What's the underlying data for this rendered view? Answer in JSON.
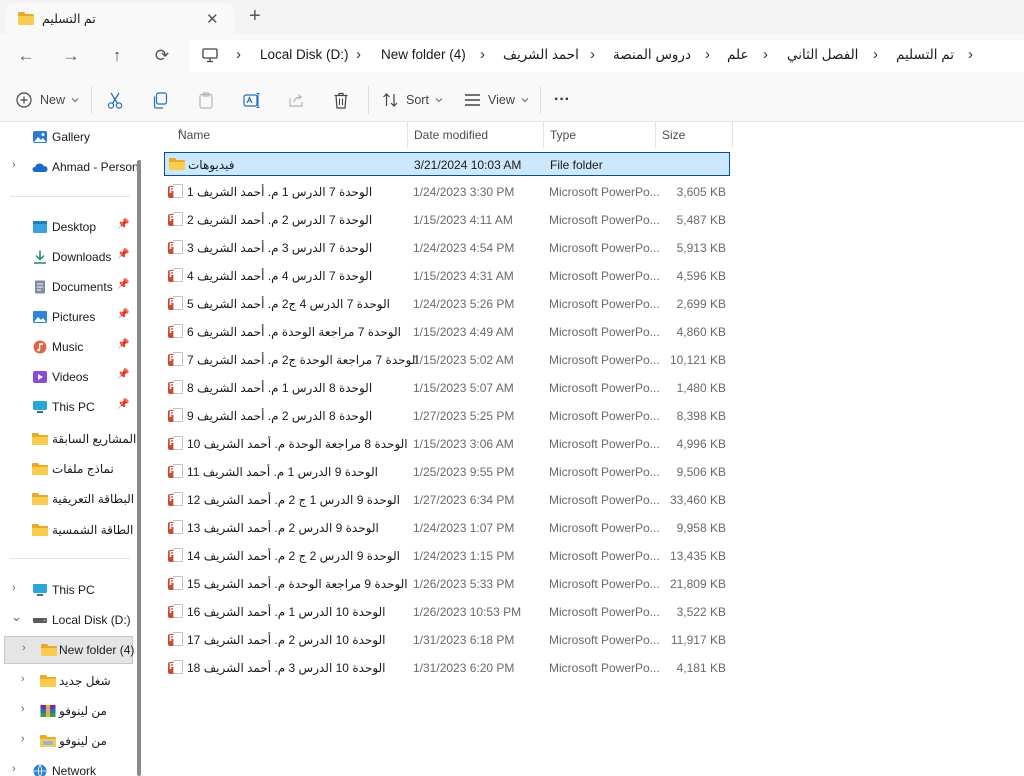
{
  "tab": {
    "title": "تم التسليم",
    "close": "✕",
    "new_tab": "+"
  },
  "nav": {
    "back": "←",
    "forward": "→",
    "up": "↑",
    "refresh": "⟳"
  },
  "breadcrumbs": [
    "Local Disk (D:)",
    "New folder (4)",
    "احمد الشريف",
    "دروس المنصة",
    "علم",
    "الفصل الثاني",
    "تم التسليم"
  ],
  "breadcrumb_separator": "›",
  "toolbar": {
    "new_label": "New",
    "sort_label": "Sort",
    "view_label": "View",
    "more_label": "···"
  },
  "sidebar": {
    "top_items": [
      {
        "label": "Gallery",
        "icon": "gallery-icon"
      },
      {
        "label": "Ahmad - Person",
        "icon": "onedrive-icon"
      }
    ],
    "quick_access": [
      {
        "label": "Desktop",
        "icon": "desktop-icon",
        "pinned": true
      },
      {
        "label": "Downloads",
        "icon": "download-icon",
        "pinned": true
      },
      {
        "label": "Documents",
        "icon": "document-icon",
        "pinned": true
      },
      {
        "label": "Pictures",
        "icon": "pictures-icon",
        "pinned": true
      },
      {
        "label": "Music",
        "icon": "music-icon",
        "pinned": true
      },
      {
        "label": "Videos",
        "icon": "videos-icon",
        "pinned": true
      },
      {
        "label": "This PC",
        "icon": "pc-icon",
        "pinned": true
      },
      {
        "label": "المشاريع السابقة",
        "icon": "folder-icon",
        "pinned": false
      },
      {
        "label": "نماذج ملفات",
        "icon": "folder-icon",
        "pinned": false
      },
      {
        "label": "البطاقة التعريفية",
        "icon": "folder-icon",
        "pinned": false
      },
      {
        "label": "الطاقة الشمسية",
        "icon": "folder-icon",
        "pinned": false
      }
    ],
    "tree": [
      {
        "label": "This PC",
        "icon": "pc-icon",
        "chevron": "›"
      },
      {
        "label": "Local Disk (D:)",
        "icon": "drive-icon",
        "chevron": "⌄"
      },
      {
        "label": "New folder (4)",
        "icon": "folder-icon",
        "chevron": "›",
        "selected": true
      },
      {
        "label": "شغل جديد",
        "icon": "folder-icon",
        "chevron": "›"
      },
      {
        "label": "من لينوفو",
        "icon": "winrar-icon",
        "chevron": "›"
      },
      {
        "label": "من لينوفو",
        "icon": "folder-icon",
        "chevron": "›"
      },
      {
        "label": "Network",
        "icon": "network-icon",
        "chevron": "›"
      }
    ]
  },
  "columns": {
    "name": "Name",
    "date": "Date modified",
    "type": "Type",
    "size": "Size",
    "sort_indicator": "^"
  },
  "files": [
    {
      "name": "فيديوهات",
      "date": "3/21/2024 10:03 AM",
      "type": "File folder",
      "size": "",
      "kind": "folder",
      "selected": true
    },
    {
      "name": "الوحدة 7 الدرس 1 م. أحمد الشريف 1",
      "date": "1/24/2023 3:30 PM",
      "type": "Microsoft PowerPo...",
      "size": "3,605 KB",
      "kind": "ppt"
    },
    {
      "name": "الوحدة 7 الدرس 2 م. أحمد الشريف 2",
      "date": "1/15/2023 4:11 AM",
      "type": "Microsoft PowerPo...",
      "size": "5,487 KB",
      "kind": "ppt"
    },
    {
      "name": "الوحدة 7 الدرس 3 م. أحمد الشريف 3",
      "date": "1/24/2023 4:54 PM",
      "type": "Microsoft PowerPo...",
      "size": "5,913 KB",
      "kind": "ppt"
    },
    {
      "name": "الوحدة 7 الدرس 4 م. أحمد الشريف 4",
      "date": "1/15/2023 4:31 AM",
      "type": "Microsoft PowerPo...",
      "size": "4,596 KB",
      "kind": "ppt"
    },
    {
      "name": "الوحدة 7 الدرس 4 ج2 م. أحمد الشريف 5",
      "date": "1/24/2023 5:26 PM",
      "type": "Microsoft PowerPo...",
      "size": "2,699 KB",
      "kind": "ppt"
    },
    {
      "name": "الوحدة 7 مراجعة الوحدة م. أحمد الشريف 6",
      "date": "1/15/2023 4:49 AM",
      "type": "Microsoft PowerPo...",
      "size": "4,860 KB",
      "kind": "ppt"
    },
    {
      "name": "الوحدة 7 مراجعة الوحدة ج2 م. أحمد الشريف 7",
      "date": "1/15/2023 5:02 AM",
      "type": "Microsoft PowerPo...",
      "size": "10,121 KB",
      "kind": "ppt"
    },
    {
      "name": "الوحدة 8 الدرس 1 م. أحمد الشريف 8",
      "date": "1/15/2023 5:07 AM",
      "type": "Microsoft PowerPo...",
      "size": "1,480 KB",
      "kind": "ppt"
    },
    {
      "name": "الوحدة 8 الدرس 2 م. أحمد الشريف 9",
      "date": "1/27/2023 5:25 PM",
      "type": "Microsoft PowerPo...",
      "size": "8,398 KB",
      "kind": "ppt"
    },
    {
      "name": "الوحدة 8 مراجعة الوحدة م. أحمد الشريف 10",
      "date": "1/15/2023 3:06 AM",
      "type": "Microsoft PowerPo...",
      "size": "4,996 KB",
      "kind": "ppt"
    },
    {
      "name": "الوحدة 9 الدرس 1 م. أحمد الشريف 11",
      "date": "1/25/2023 9:55 PM",
      "type": "Microsoft PowerPo...",
      "size": "9,506 KB",
      "kind": "ppt"
    },
    {
      "name": "الوحدة 9 الدرس 1 ج 2 م. أحمد الشريف 12",
      "date": "1/27/2023 6:34 PM",
      "type": "Microsoft PowerPo...",
      "size": "33,460 KB",
      "kind": "ppt"
    },
    {
      "name": "الوحدة 9 الدرس 2 م. أحمد الشريف 13",
      "date": "1/24/2023 1:07 PM",
      "type": "Microsoft PowerPo...",
      "size": "9,958 KB",
      "kind": "ppt"
    },
    {
      "name": "الوحدة 9 الدرس 2 ج 2 م. أحمد الشريف 14",
      "date": "1/24/2023 1:15 PM",
      "type": "Microsoft PowerPo...",
      "size": "13,435 KB",
      "kind": "ppt"
    },
    {
      "name": "الوحدة 9 مراجعة الوحدة م. أحمد الشريف 15",
      "date": "1/26/2023 5:33 PM",
      "type": "Microsoft PowerPo...",
      "size": "21,809 KB",
      "kind": "ppt"
    },
    {
      "name": "الوحدة 10 الدرس 1 م. أحمد الشريف 16",
      "date": "1/26/2023 10:53 PM",
      "type": "Microsoft PowerPo...",
      "size": "3,522 KB",
      "kind": "ppt"
    },
    {
      "name": "الوحدة 10 الدرس 2 م. أحمد الشريف 17",
      "date": "1/31/2023 6:18 PM",
      "type": "Microsoft PowerPo...",
      "size": "11,917 KB",
      "kind": "ppt"
    },
    {
      "name": "الوحدة 10 الدرس 3 م. أحمد الشريف 18",
      "date": "1/31/2023 6:20 PM",
      "type": "Microsoft PowerPo...",
      "size": "4,181 KB",
      "kind": "ppt"
    }
  ],
  "colors": {
    "accent": "#0a4e86",
    "selection": "#cce8ff",
    "folder": "#f5c542",
    "ppt": "#d14a2f"
  }
}
